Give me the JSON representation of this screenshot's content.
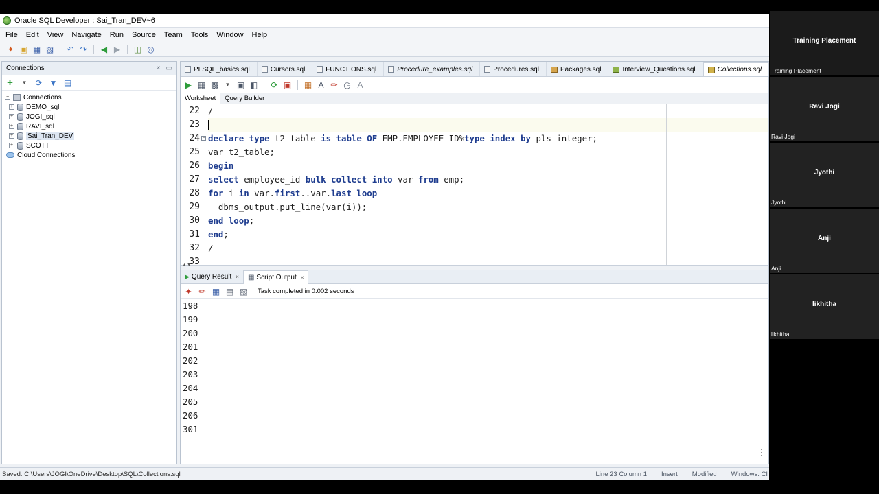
{
  "window": {
    "title": "Oracle SQL Developer : Sai_Tran_DEV~6"
  },
  "menu": [
    "File",
    "Edit",
    "View",
    "Navigate",
    "Run",
    "Source",
    "Team",
    "Tools",
    "Window",
    "Help"
  ],
  "connections_panel": {
    "title": "Connections",
    "root": "Connections",
    "items": [
      "DEMO_sql",
      "JOGI_sql",
      "RAVI_sql",
      "Sai_Tran_DEV",
      "SCOTT"
    ],
    "selected": "Sai_Tran_DEV",
    "cloud": "Cloud Connections"
  },
  "file_tabs": [
    {
      "label": "PLSQL_basics.sql"
    },
    {
      "label": "Cursors.sql"
    },
    {
      "label": "FUNCTIONS.sql"
    },
    {
      "label": "Procedure_examples.sql"
    },
    {
      "label": "Procedures.sql"
    },
    {
      "label": "Packages.sql"
    },
    {
      "label": "Interview_Questions.sql"
    },
    {
      "label": "Collections.sql"
    }
  ],
  "worksheet_tabs": [
    "Worksheet",
    "Query Builder"
  ],
  "editor": {
    "line_numbers": [
      "22",
      "23",
      "24",
      "25",
      "26",
      "27",
      "28",
      "29",
      "30",
      "31",
      "32",
      "33"
    ]
  },
  "result_tabs": [
    "Query Result",
    "Script Output"
  ],
  "output": {
    "status": "Task completed in 0.002 seconds",
    "lines": [
      "198",
      "199",
      "200",
      "201",
      "202",
      "203",
      "204",
      "205",
      "206",
      "301"
    ]
  },
  "statusbar": {
    "saved": "Saved: C:\\Users\\JOGI\\OneDrive\\Desktop\\SQL\\Collections.sql",
    "position": "Line 23 Column 1",
    "mode": "Insert",
    "modified": "Modified",
    "eol": "Windows: CI"
  },
  "participants": [
    {
      "center": "Training Placement",
      "corner": "Training Placement"
    },
    {
      "center": "Ravi Jogi",
      "corner": "Ravi Jogi"
    },
    {
      "center": "Jyothi",
      "corner": "Jyothi"
    },
    {
      "center": "Anji",
      "corner": "Anji"
    },
    {
      "center": "likhitha",
      "corner": "likhitha"
    }
  ]
}
